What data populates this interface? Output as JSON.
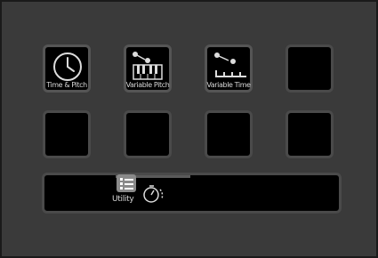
{
  "pads": [
    {
      "label": "Time & Pitch",
      "icon": "clock-icon"
    },
    {
      "label": "Variable Pitch",
      "icon": "keyboard-icon"
    },
    {
      "label": "Variable Time",
      "icon": "ruler-icon"
    },
    {
      "label": "",
      "icon": ""
    },
    {
      "label": "",
      "icon": ""
    },
    {
      "label": "",
      "icon": ""
    },
    {
      "label": "",
      "icon": ""
    },
    {
      "label": "",
      "icon": ""
    }
  ],
  "utility": {
    "label": "Utility",
    "icons": [
      "list-icon",
      "tuner-icon"
    ]
  },
  "colors": {
    "background": "#3a3a3a",
    "pad_fill": "#000000",
    "pad_border": "#4a4a4a",
    "text": "#d8d8d8"
  }
}
